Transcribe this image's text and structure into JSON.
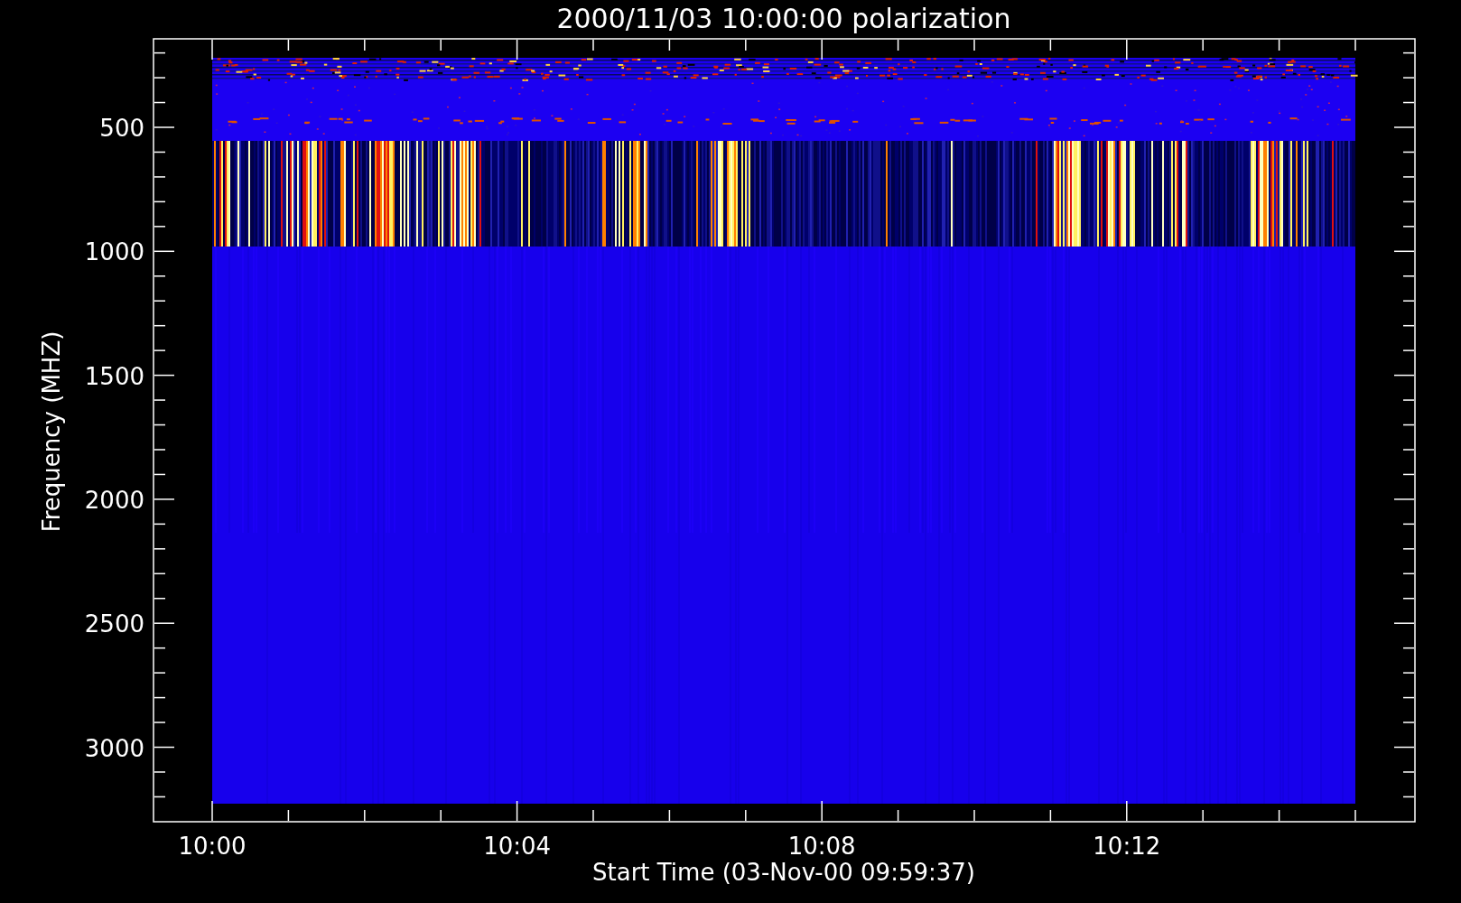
{
  "plot": {
    "title": "2000/11/03 10:00:00 polarization",
    "xlabel": "Start Time (03-Nov-00 09:59:37)",
    "ylabel": "Frequency (MHZ)",
    "xtick_labels": [
      "10:00",
      "10:04",
      "10:08",
      "10:12"
    ],
    "ytick_labels": [
      "500",
      "1000",
      "1500",
      "2000",
      "2500",
      "3000"
    ]
  }
}
